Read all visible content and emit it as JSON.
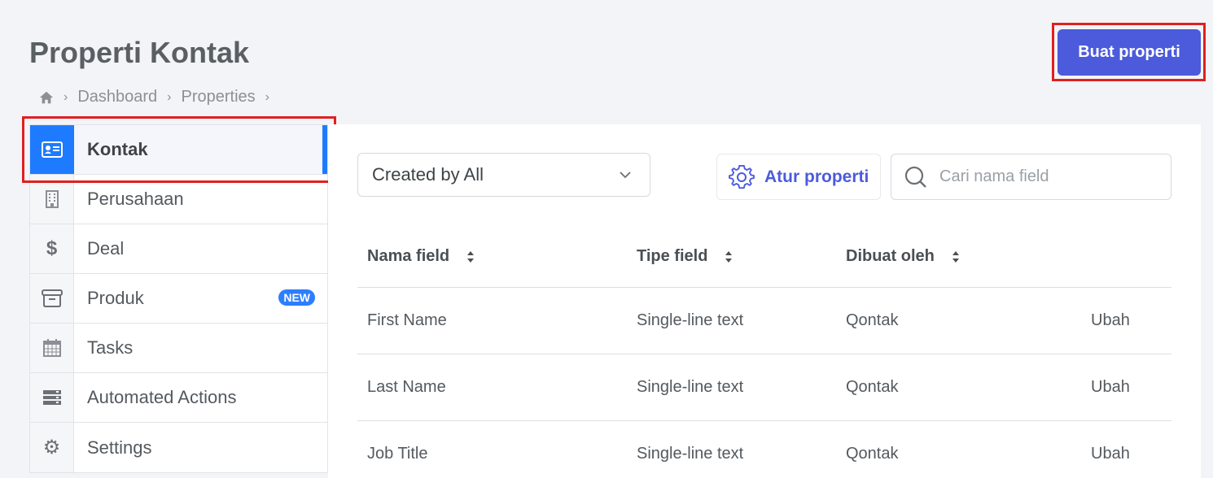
{
  "header": {
    "title": "Properti Kontak",
    "create_button": "Buat properti"
  },
  "breadcrumb": {
    "items": [
      "Dashboard",
      "Properties"
    ]
  },
  "sidebar": {
    "items": [
      {
        "label": "Kontak",
        "icon": "contact-card-icon",
        "active": true
      },
      {
        "label": "Perusahaan",
        "icon": "building-icon"
      },
      {
        "label": "Deal",
        "icon": "dollar-icon"
      },
      {
        "label": "Produk",
        "icon": "archive-box-icon",
        "badge": "NEW"
      },
      {
        "label": "Tasks",
        "icon": "calendar-icon"
      },
      {
        "label": "Automated Actions",
        "icon": "server-stack-icon"
      },
      {
        "label": "Settings",
        "icon": "gear-icon"
      }
    ]
  },
  "toolbar": {
    "filter_value": "Created by All",
    "settings_label": "Atur properti",
    "search_placeholder": "Cari nama field"
  },
  "table": {
    "columns": [
      "Nama field",
      "Tipe field",
      "Dibuat oleh"
    ],
    "rows": [
      {
        "name": "First Name",
        "type": "Single-line text",
        "creator": "Qontak",
        "action": "Ubah"
      },
      {
        "name": "Last Name",
        "type": "Single-line text",
        "creator": "Qontak",
        "action": "Ubah"
      },
      {
        "name": "Job Title",
        "type": "Single-line text",
        "creator": "Qontak",
        "action": "Ubah"
      }
    ]
  },
  "colors": {
    "primary": "#4b5bdc",
    "active": "#1e7bff",
    "highlight": "#e02020"
  }
}
